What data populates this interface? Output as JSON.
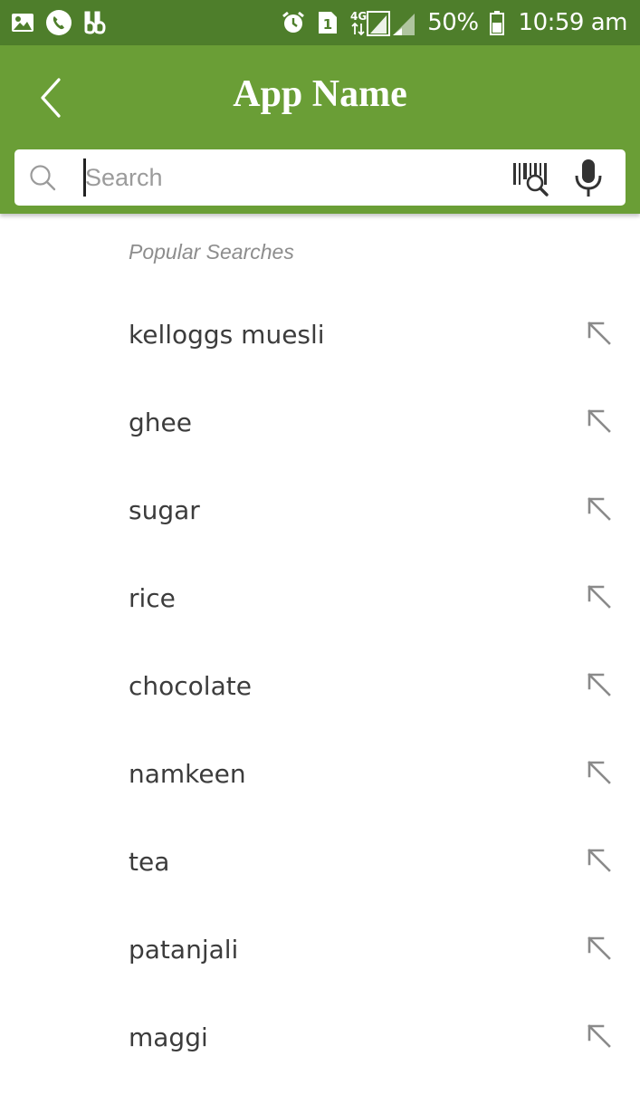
{
  "status_bar": {
    "sim_badge": "1",
    "network_type": "4G",
    "battery_percent": "50%",
    "time": "10:59 am",
    "icons": [
      "gallery-icon",
      "phone-icon",
      "app-notification-icon",
      "alarm-icon",
      "sim-icon",
      "signal-icon",
      "battery-icon"
    ]
  },
  "app_bar": {
    "title": "App Name",
    "back_icon": "back-chevron-icon",
    "color": "#6a9e36"
  },
  "search": {
    "placeholder": "Search",
    "value": "",
    "icons": [
      "search-icon",
      "barcode-scan-icon",
      "microphone-icon"
    ]
  },
  "popular": {
    "heading": "Popular Searches",
    "items": [
      {
        "label": "kelloggs muesli"
      },
      {
        "label": "ghee"
      },
      {
        "label": "sugar"
      },
      {
        "label": "rice"
      },
      {
        "label": "chocolate"
      },
      {
        "label": "namkeen"
      },
      {
        "label": "tea"
      },
      {
        "label": "patanjali"
      },
      {
        "label": "maggi"
      }
    ],
    "item_action_icon": "arrow-up-left-icon"
  },
  "colors": {
    "status_bar": "#4e7e2b",
    "app_bar": "#6a9e36",
    "text": "#3c3c3c",
    "muted": "#8d8d8d"
  }
}
